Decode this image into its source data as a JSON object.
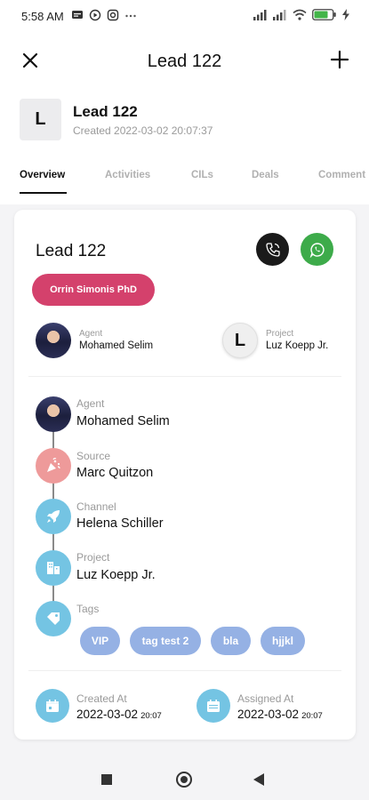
{
  "status_bar": {
    "time": "5:58 AM",
    "battery": "84"
  },
  "app_bar": {
    "title": "Lead 122"
  },
  "lead_header": {
    "avatar_letter": "L",
    "name": "Lead 122",
    "created": "Created 2022-03-02 20:07:37"
  },
  "tabs": [
    {
      "label": "Overview"
    },
    {
      "label": "Activities"
    },
    {
      "label": "CILs"
    },
    {
      "label": "Deals"
    },
    {
      "label": "Comment"
    }
  ],
  "card": {
    "title": "Lead 122",
    "owner_pill": "Orrin Simonis PhD",
    "mini": {
      "agent_label": "Agent",
      "agent_value": "Mohamed Selim",
      "project_letter": "L",
      "project_label": "Project",
      "project_value": "Luz Koepp Jr."
    },
    "timeline": [
      {
        "label": "Agent",
        "value": "Mohamed Selim",
        "icon": "user-photo"
      },
      {
        "label": "Source",
        "value": "Marc Quitzon",
        "icon": "party-popper-icon",
        "color": "#ee9a9a"
      },
      {
        "label": "Channel",
        "value": "Helena Schiller",
        "icon": "rocket-icon",
        "color": "#74c4e3"
      },
      {
        "label": "Project",
        "value": "Luz Koepp Jr.",
        "icon": "building-icon",
        "color": "#74c4e3"
      },
      {
        "label": "Tags",
        "icon": "tag-icon",
        "color": "#74c4e3"
      }
    ],
    "tags": [
      "VIP",
      "tag test 2",
      "bla",
      "hjjkl"
    ],
    "created_at": {
      "label": "Created At",
      "date": "2022-03-02",
      "time": "20:07"
    },
    "assigned_at": {
      "label": "Assigned At",
      "date": "2022-03-02",
      "time": "20:07"
    }
  },
  "colors": {
    "accent_pink": "#d4416c",
    "whatsapp_green": "#3dab4a",
    "tag_blue": "#95b1e4",
    "icon_blue": "#74c4e3",
    "source_pink": "#ee9a9a"
  }
}
